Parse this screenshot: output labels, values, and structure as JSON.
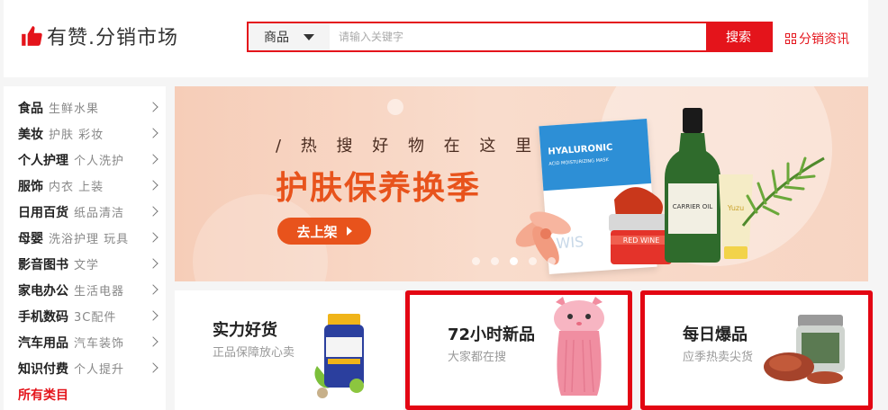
{
  "header": {
    "logo_text": "有赞.分销市场",
    "search": {
      "category": "商品",
      "placeholder": "请输入关键字",
      "button": "搜索"
    },
    "news_link": "分销资讯"
  },
  "sidebar": {
    "items": [
      {
        "main": "食品",
        "sub": "生鲜水果"
      },
      {
        "main": "美妆",
        "sub": "护肤 彩妆"
      },
      {
        "main": "个人护理",
        "sub": "个人洗护"
      },
      {
        "main": "服饰",
        "sub": "内衣 上装"
      },
      {
        "main": "日用百货",
        "sub": "纸品清洁"
      },
      {
        "main": "母婴",
        "sub": "洗浴护理 玩具"
      },
      {
        "main": "影音图书",
        "sub": "文学"
      },
      {
        "main": "家电办公",
        "sub": "生活电器"
      },
      {
        "main": "手机数码",
        "sub": "3C配件"
      },
      {
        "main": "汽车用品",
        "sub": "汽车装饰"
      },
      {
        "main": "知识付费",
        "sub": "个人提升"
      }
    ],
    "all_categories": "所有类目"
  },
  "banner": {
    "tagline": "/ 热 搜 好 物 在 这 里 /",
    "headline": "护肤保养换季",
    "cta": "去上架",
    "mask_title": "HYALURONIC",
    "mask_sub": "ACID MOISTURIZING MASK",
    "mask_brand": "WIS",
    "jar_label": "RED WINE",
    "bottle_label": "CARRIER OIL",
    "tube_label": "Yuzu",
    "slide_count": 6,
    "active_slide": 3
  },
  "promos": [
    {
      "title": "实力好货",
      "subtitle": "正品保障放心卖",
      "highlighted": false
    },
    {
      "title": "72小时新品",
      "subtitle": "大家都在搜",
      "highlighted": true
    },
    {
      "title": "每日爆品",
      "subtitle": "应季热卖尖货",
      "highlighted": true
    }
  ],
  "colors": {
    "brand_red": "#e4141b",
    "banner_orange": "#e8531c",
    "highlight_border": "#e30613"
  }
}
